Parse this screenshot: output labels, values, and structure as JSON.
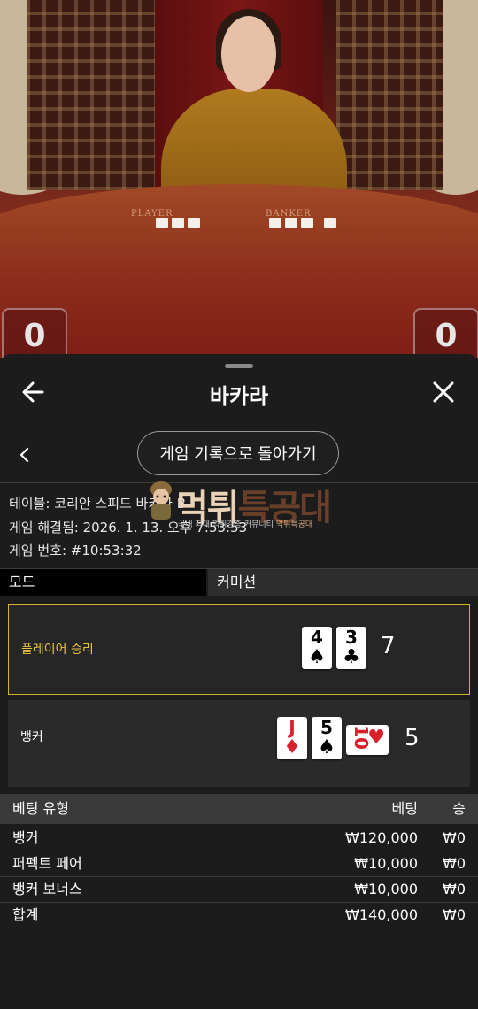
{
  "video": {
    "table_labels": [
      "PLAYER",
      "BANKER"
    ],
    "player_score": "0",
    "banker_score": "0"
  },
  "header": {
    "title": "바카라"
  },
  "history_button": "게임 기록으로 돌아가기",
  "info": {
    "table": "테이블: 코리안 스피드 바카라 B",
    "settled": "게임 해결됨: 2026. 1. 13. 오후 7:53:53",
    "game_number": "게임 번호: #10:53:32"
  },
  "watermark": {
    "title_a": "먹튀",
    "title_b": "특공대",
    "subtitle_pre": "국내 최대 먹튀검증 커뮤니티 ",
    "subtitle_hl": "먹튀특공대"
  },
  "tabs": {
    "mode": "모드",
    "commission": "커미션"
  },
  "result": {
    "player": {
      "label": "플레이어 승리",
      "cards": [
        {
          "rank": "4",
          "suit": "♠"
        },
        {
          "rank": "3",
          "suit": "♣"
        }
      ],
      "total": "7"
    },
    "banker": {
      "label": "뱅커",
      "cards": [
        {
          "rank": "J",
          "suit": "♦"
        },
        {
          "rank": "5",
          "suit": "♠"
        },
        {
          "rank": "10",
          "suit": "♥"
        }
      ],
      "total": "5"
    }
  },
  "bets": {
    "headers": {
      "type": "베팅 유형",
      "bet": "베팅",
      "win": "승"
    },
    "rows": [
      {
        "type": "뱅커",
        "bet": "₩120,000",
        "win": "₩0"
      },
      {
        "type": "퍼펙트 페어",
        "bet": "₩10,000",
        "win": "₩0"
      },
      {
        "type": "뱅커 보너스",
        "bet": "₩10,000",
        "win": "₩0"
      },
      {
        "type": "합계",
        "bet": "₩140,000",
        "win": "₩0"
      }
    ]
  },
  "colors": {
    "accent_gold": "#e9c640",
    "sheet_bg": "#1c1c1c",
    "red_suit": "#d81f2a"
  }
}
